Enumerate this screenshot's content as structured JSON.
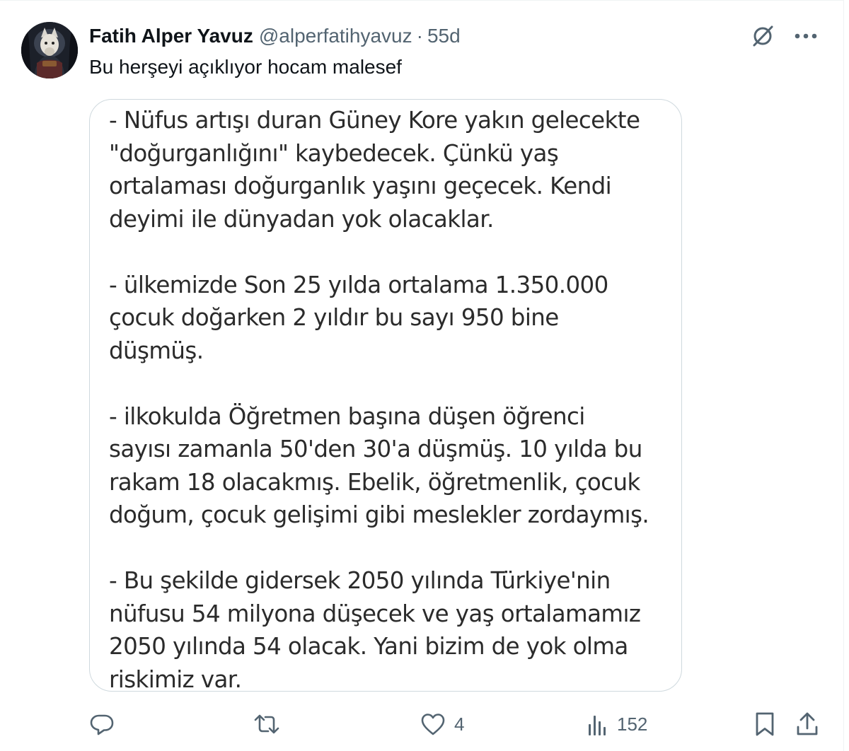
{
  "tweet": {
    "display_name": "Fatih Alper Yavuz",
    "handle": "@alperfatihyavuz",
    "separator": "·",
    "time": "55d",
    "text": "Bu herşeyi açıklıyor hocam malesef"
  },
  "media": {
    "paragraphs": [
      "- Nüfus artışı duran Güney Kore yakın gelecekte\n\"doğurganlığını\" kaybedecek. Çünkü yaş\nortalaması doğurganlık yaşını geçecek. Kendi\ndeyimi ile dünyadan yok olacaklar.",
      "- ülkemizde Son 25 yılda ortalama 1.350.000\nçocuk doğarken 2 yıldır bu sayı 950 bine\ndüşmüş.",
      "- ilkokulda Öğretmen başına düşen öğrenci\nsayısı zamanla 50'den 30'a düşmüş. 10 yılda bu\nrakam 18 olacakmış. Ebelik, öğretmenlik, çocuk\ndoğum, çocuk gelişimi gibi meslekler zordaymış.",
      "- Bu şekilde gidersek 2050 yılında Türkiye'nin\nnüfusu 54 milyona düşecek ve yaş ortalamamız\n2050 yılında 54 olacak. Yani bizim de yok olma\nriskimiz var."
    ]
  },
  "actions": {
    "reply_count": "",
    "retweet_count": "",
    "like_count": "4",
    "views_count": "152"
  },
  "icons": {
    "grok": "grok-icon",
    "more": "more-icon",
    "reply": "reply-icon",
    "retweet": "retweet-icon",
    "like": "heart-icon",
    "views": "views-icon",
    "bookmark": "bookmark-icon",
    "share": "share-icon"
  },
  "colors": {
    "text": "#0f1419",
    "muted": "#536471",
    "border": "#cfd9de"
  }
}
